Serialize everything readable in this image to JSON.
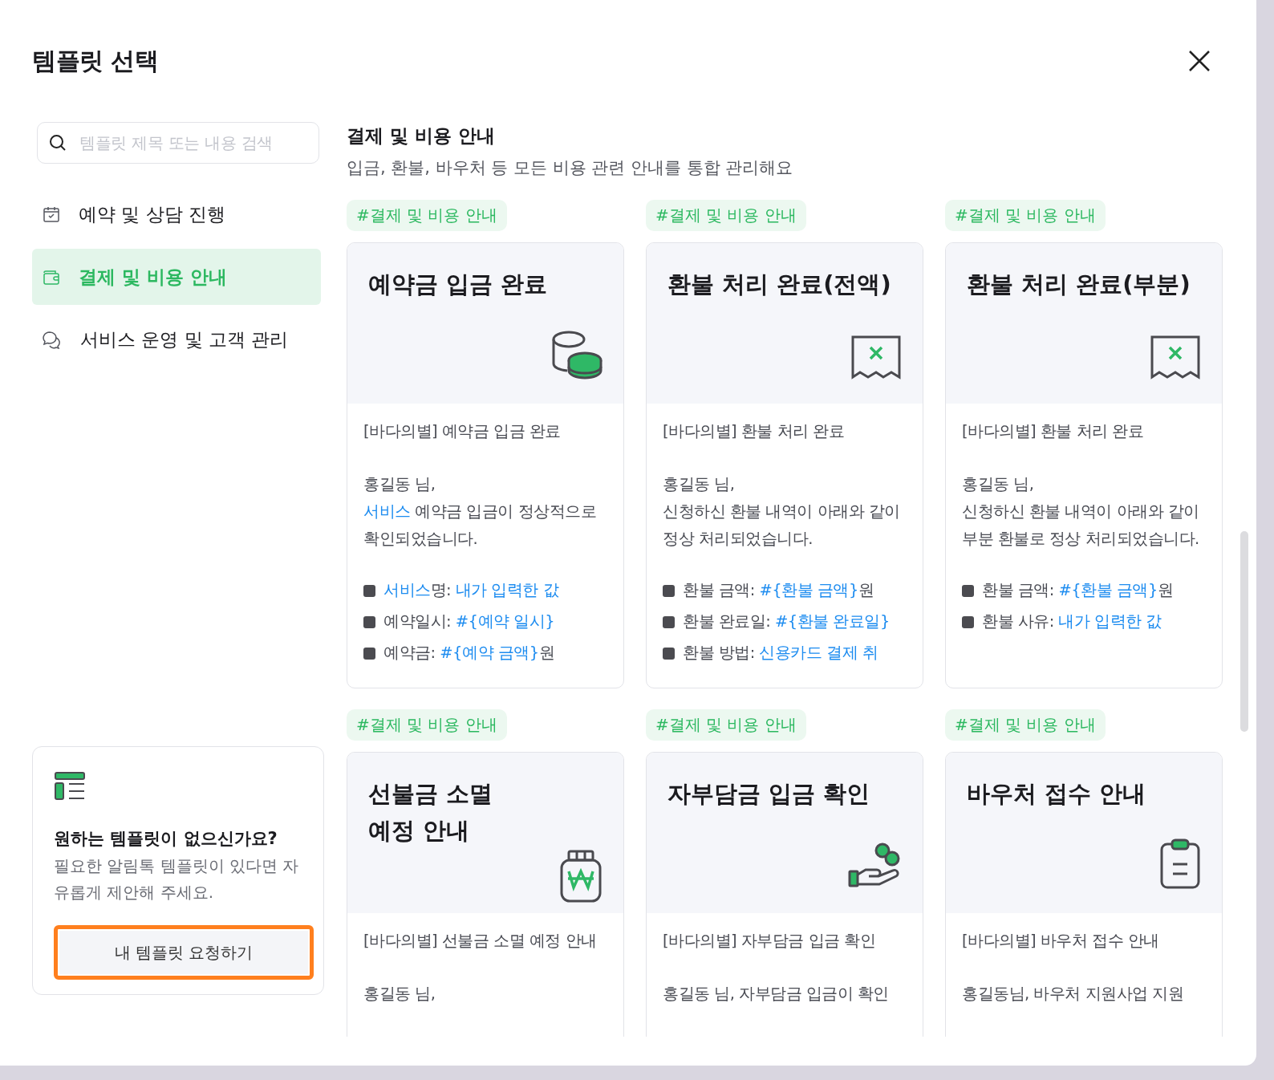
{
  "title": "템플릿 선택",
  "search": {
    "placeholder": "템플릿 제목 또는 내용 검색"
  },
  "categories": [
    {
      "label": "예약 및 상담 진행",
      "kind": "calendar",
      "selected": false
    },
    {
      "label": "결제 및 비용 안내",
      "kind": "wallet",
      "selected": true
    },
    {
      "label": "서비스 운영 및 고객 관리",
      "kind": "chat",
      "selected": false
    }
  ],
  "request_card": {
    "heading": "원하는 템플릿이 없으신가요?",
    "text": "필요한 알림톡 템플릿이 있다면 자유롭게 제안해 주세요.",
    "button": "내 템플릿 요청하기",
    "focused": true
  },
  "section": {
    "title": "결제 및 비용 안내",
    "subtitle": "입금, 환불, 바우처 등 모든 비용 관련 안내를 통합 관리해요"
  },
  "templates": [
    {
      "tag": "#결제 및 비용 안내",
      "title": "예약금 입금 완료",
      "kind": "coins",
      "subject": "[바다의별] 예약금 입금 완료",
      "greeting": "홍길동 님,",
      "message": [
        {
          "text": "서비스",
          "var": true
        },
        {
          "text": " 예약금 입금이 정상적으로 확인되었습니다.",
          "var": false
        }
      ],
      "fields": [
        [
          {
            "text": "서비스",
            "var": true
          },
          {
            "text": "명: ",
            "var": false
          },
          {
            "text": "내가 입력한 값",
            "var": true
          }
        ],
        [
          {
            "text": "예약일시: ",
            "var": false
          },
          {
            "text": "#{예약 일시}",
            "var": true
          }
        ],
        [
          {
            "text": "예약금: ",
            "var": false
          },
          {
            "text": "#{예약 금액}",
            "var": true
          },
          {
            "text": "원",
            "var": false
          }
        ]
      ]
    },
    {
      "tag": "#결제 및 비용 안내",
      "title": "환불 처리 완료(전액)",
      "kind": "receipt",
      "subject": "[바다의별] 환불 처리 완료",
      "greeting": "홍길동 님,",
      "message": [
        {
          "text": "신청하신 환불 내역이 아래와 같이 정상 처리되었습니다.",
          "var": false
        }
      ],
      "fields": [
        [
          {
            "text": "환불 금액: ",
            "var": false
          },
          {
            "text": "#{환불 금액}",
            "var": true
          },
          {
            "text": "원",
            "var": false
          }
        ],
        [
          {
            "text": "환불 완료일: ",
            "var": false
          },
          {
            "text": "#{환불 완료일}",
            "var": true
          }
        ],
        [
          {
            "text": "환불 방법: ",
            "var": false
          },
          {
            "text": "신용카드 결제 취",
            "var": true
          }
        ]
      ]
    },
    {
      "tag": "#결제 및 비용 안내",
      "title": "환불 처리 완료(부분)",
      "kind": "receipt",
      "subject": "[바다의별] 환불 처리 완료",
      "greeting": "홍길동 님,",
      "message": [
        {
          "text": "신청하신 환불 내역이 아래와 같이 부분 환불로 정상 처리되었습니다.",
          "var": false
        }
      ],
      "fields": [
        [
          {
            "text": "환불 금액: ",
            "var": false
          },
          {
            "text": "#{환불 금액}",
            "var": true
          },
          {
            "text": "원",
            "var": false
          }
        ],
        [
          {
            "text": "환불 사유: ",
            "var": false
          },
          {
            "text": "내가 입력한 값",
            "var": true
          }
        ]
      ]
    },
    {
      "tag": "#결제 및 비용 안내",
      "title": "선불금 소멸\n예정 안내",
      "kind": "jar",
      "subject": "[바다의별] 선불금 소멸 예정 안내",
      "greeting": "홍길동 님,"
    },
    {
      "tag": "#결제 및 비용 안내",
      "title": "자부담금 입금 확인",
      "kind": "hand",
      "subject": "[바다의별] 자부담금 입금 확인",
      "greeting": "홍길동 님, 자부담금 입금이 확인"
    },
    {
      "tag": "#결제 및 비용 안내",
      "title": "바우처 접수 안내",
      "kind": "clipboard",
      "subject": "[바다의별] 바우처 접수 안내",
      "greeting": "홍길동님, 바우처 지원사업 지원"
    }
  ]
}
